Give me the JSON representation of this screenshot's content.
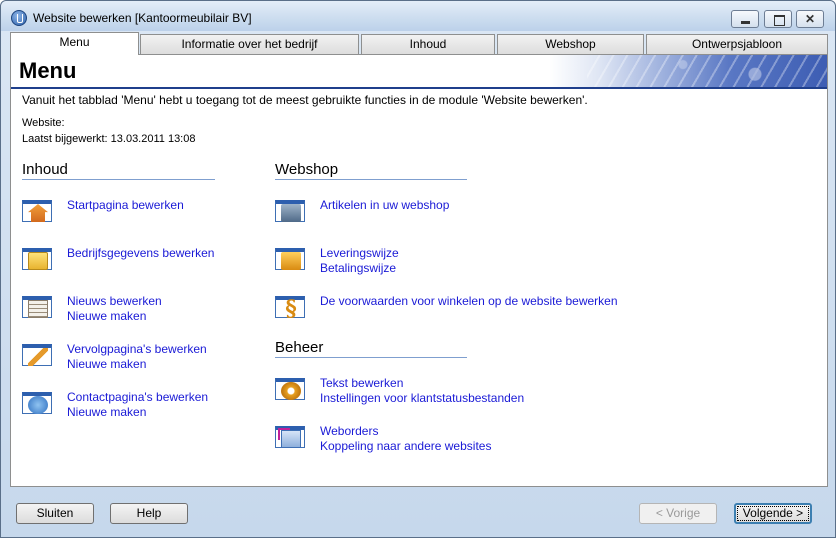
{
  "window": {
    "title": "Website bewerken [Kantoormeubilair BV]",
    "close_glyph": "✕"
  },
  "tabs": [
    {
      "label": "Menu",
      "active": true
    },
    {
      "label": "Informatie over het bedrijf",
      "active": false
    },
    {
      "label": "Inhoud",
      "active": false
    },
    {
      "label": "Webshop",
      "active": false
    },
    {
      "label": "Ontwerpsjabloon",
      "active": false
    }
  ],
  "page": {
    "title": "Menu",
    "intro": "Vanuit het tabblad 'Menu' hebt u toegang tot de meest gebruikte functies in de module 'Website bewerken'.",
    "website_label": "Website:",
    "updated_label": "Laatst bijgewerkt: 13.03.2011 13:08"
  },
  "sections": {
    "inhoud": {
      "title": "Inhoud",
      "items": [
        {
          "icon": "home-icon",
          "links": [
            "Startpagina bewerken"
          ]
        },
        {
          "icon": "folder-icon",
          "links": [
            "Bedrijfsgegevens bewerken"
          ]
        },
        {
          "icon": "newspaper-icon",
          "links": [
            "Nieuws bewerken",
            "Nieuwe maken"
          ]
        },
        {
          "icon": "pencil-icon",
          "links": [
            "Vervolgpagina's bewerken",
            "Nieuwe maken"
          ]
        },
        {
          "icon": "contact-icon",
          "links": [
            "Contactpagina's bewerken",
            "Nieuwe maken"
          ]
        }
      ]
    },
    "webshop": {
      "title": "Webshop",
      "items": [
        {
          "icon": "shop-icon",
          "links": [
            "Artikelen in uw webshop"
          ]
        },
        {
          "icon": "delivery-truck-icon",
          "links": [
            "Leveringswijze",
            "Betalingswijze"
          ]
        },
        {
          "icon": "paragraph-icon",
          "glyph": "§",
          "links": [
            "De voorwaarden voor winkelen op de website bewerken"
          ]
        }
      ]
    },
    "beheer": {
      "title": "Beheer",
      "items": [
        {
          "icon": "settings-gear-icon",
          "links": [
            "Tekst bewerken",
            "Instellingen voor klantstatusbestanden"
          ]
        },
        {
          "icon": "orders-icon",
          "links": [
            "Weborders",
            "Koppeling naar andere websites"
          ]
        }
      ]
    }
  },
  "footer": {
    "close_label": "Sluiten",
    "help_label": "Help",
    "prev_label": "< Vorige",
    "next_label": "Volgende >"
  },
  "colors": {
    "link": "#1a1ad6",
    "accent_blue": "#1f3f8c"
  }
}
